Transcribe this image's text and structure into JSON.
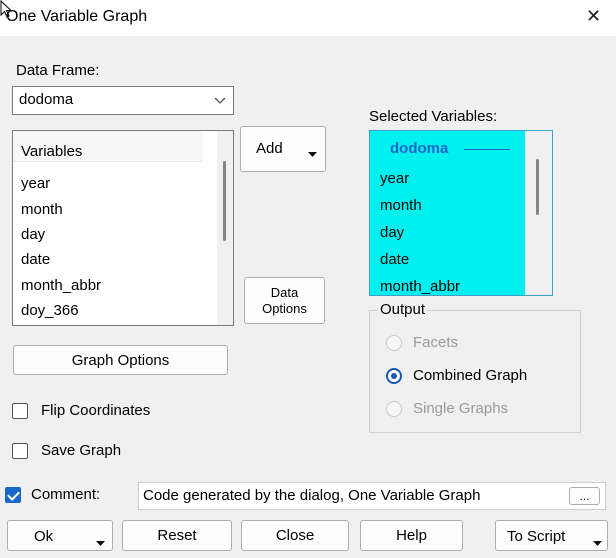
{
  "window": {
    "title": "One Variable Graph",
    "close_glyph": "✕"
  },
  "data_frame": {
    "label": "Data Frame:",
    "value": "dodoma"
  },
  "variables_list": {
    "header": "Variables",
    "items": [
      "year",
      "month",
      "day",
      "date",
      "month_abbr",
      "doy_366"
    ]
  },
  "add_button": {
    "label": "Add"
  },
  "data_options_button": {
    "line1": "Data",
    "line2": "Options"
  },
  "selected": {
    "label": "Selected Variables:",
    "group": "dodoma",
    "items": [
      "year",
      "month",
      "day",
      "date",
      "month_abbr"
    ],
    "background": "#00f0f0"
  },
  "output": {
    "title": "Output",
    "options": [
      {
        "label": "Facets",
        "selected": false,
        "enabled": false
      },
      {
        "label": "Combined Graph",
        "selected": true,
        "enabled": true
      },
      {
        "label": "Single Graphs",
        "selected": false,
        "enabled": false
      }
    ]
  },
  "graph_options_button": {
    "label": "Graph Options"
  },
  "flip_coordinates": {
    "label": "Flip Coordinates",
    "checked": false
  },
  "save_graph": {
    "label": "Save Graph",
    "checked": false
  },
  "comment": {
    "label": "Comment:",
    "checked": true,
    "value": "Code generated by the dialog, One Variable Graph",
    "ellipsis": "..."
  },
  "bottom": {
    "ok": "Ok",
    "reset": "Reset",
    "close": "Close",
    "help": "Help",
    "to_script": "To Script"
  },
  "colors": {
    "accent": "#1a57b5",
    "selected_bg": "#00f0f0",
    "group_text": "#1f66c9"
  }
}
